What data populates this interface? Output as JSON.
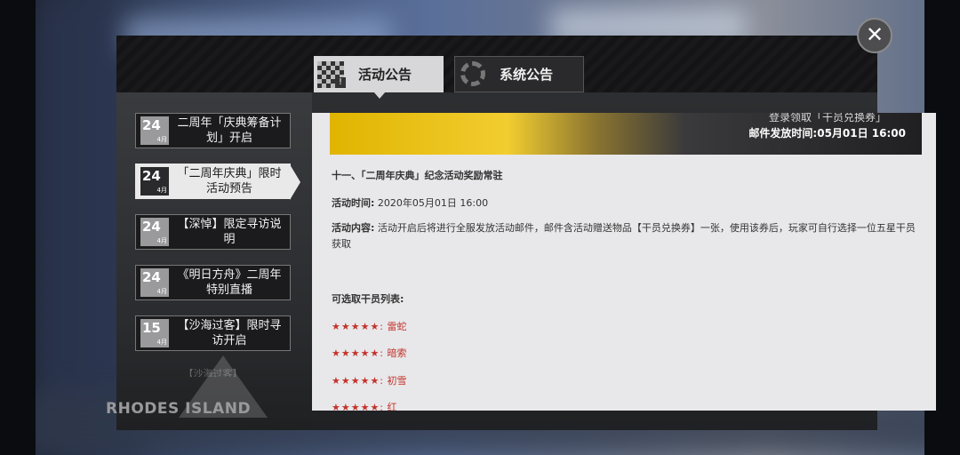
{
  "tabs": [
    {
      "label": "活动公告",
      "active": true
    },
    {
      "label": "系统公告",
      "active": false
    }
  ],
  "notices": [
    {
      "day": "24",
      "month": "4月",
      "title": "二周年「庆典筹备计划」开启",
      "selected": false
    },
    {
      "day": "24",
      "month": "4月",
      "title": "「二周年庆典」限时活动预告",
      "selected": true
    },
    {
      "day": "24",
      "month": "4月",
      "title": "【深悼】限定寻访说明",
      "selected": false
    },
    {
      "day": "24",
      "month": "4月",
      "title": "《明日方舟》二周年特别直播",
      "selected": false
    },
    {
      "day": "15",
      "month": "4月",
      "title": "【沙海过客】限时寻访开启",
      "selected": false
    }
  ],
  "partial_notice": "【沙海过客】",
  "brand": "RHODES ISLAND",
  "banner": {
    "mail_time": "邮件发放时间:05月01日 16:00",
    "top_text": "登录领取「干员兑换券」"
  },
  "content": {
    "heading": "十一、「二周年庆典」纪念活动奖励常驻",
    "time_label": "活动时间:",
    "time_value": "2020年05月01日 16:00",
    "desc_label": "活动内容:",
    "desc_value": "活动开启后将进行全服发放活动邮件，邮件含活动赠送物品【干员兑换券】一张，使用该券后，玩家可自行选择一位五星干员获取",
    "list_title": "可选取干员列表:",
    "operators": [
      {
        "stars": "★★★★★:",
        "name": "雷蛇"
      },
      {
        "stars": "★★★★★:",
        "name": "暗索"
      },
      {
        "stars": "★★★★★:",
        "name": "初雪"
      },
      {
        "stars": "★★★★★:",
        "name": "红"
      }
    ]
  },
  "close_icon": "close-icon"
}
